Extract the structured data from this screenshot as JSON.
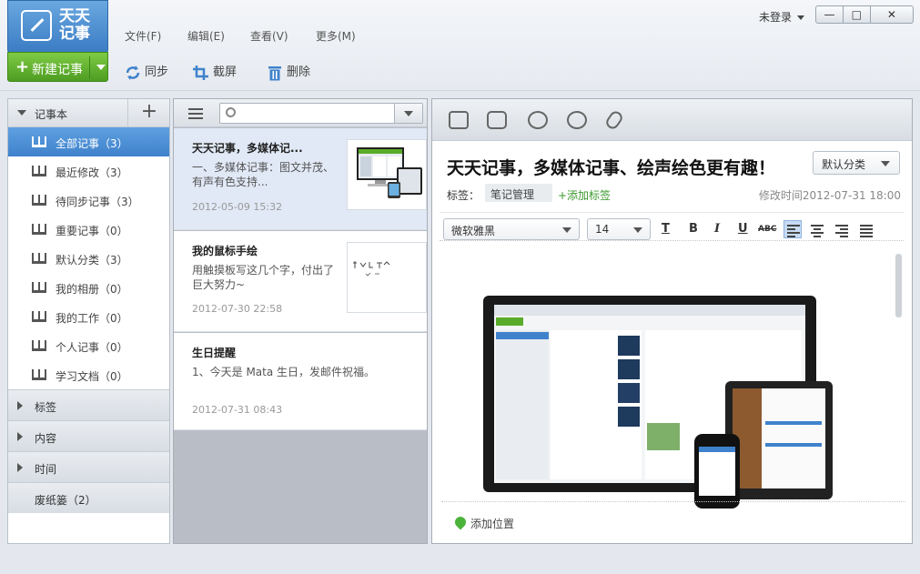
{
  "app": {
    "logo_text": "天天记事",
    "new_note_label": "新建记事"
  },
  "menu": [
    "文件(F)",
    "编辑(E)",
    "查看(V)",
    "更多(M)"
  ],
  "toolbar": {
    "sync": "同步",
    "screenshot": "截屏",
    "delete": "删除"
  },
  "user": {
    "status": "未登录"
  },
  "window": {
    "min": "—",
    "max": "□",
    "close": "✕"
  },
  "sidebar": {
    "header": "记事本",
    "add": "+",
    "notebooks": [
      {
        "label": "全部记事（3）",
        "selected": true
      },
      {
        "label": "最近修改（3）"
      },
      {
        "label": "待同步记事（3）"
      },
      {
        "label": "重要记事（0）"
      },
      {
        "label": "默认分类（3）"
      },
      {
        "label": "我的相册（0）"
      },
      {
        "label": "我的工作（0）"
      },
      {
        "label": "个人记事（0）"
      },
      {
        "label": "学习文档（0）"
      }
    ],
    "sections": [
      "标签",
      "内容",
      "时间"
    ],
    "trash": "废纸篓（2）"
  },
  "notes": [
    {
      "title": "天天记事，多媒体记...",
      "snippet": "一、多媒体记事：图文并茂、有声有色支持...",
      "date": "2012-05-09 15:32",
      "selected": true
    },
    {
      "title": "我的鼠标手绘",
      "snippet": "用触摸板写这几个字，付出了巨大努力~",
      "date": "2012-07-30 22:58"
    },
    {
      "title": "生日提醒",
      "snippet": "1、今天是 Mata 生日，发邮件祝福。",
      "date": "2012-07-31 08:43"
    }
  ],
  "editor": {
    "title": "天天记事，多媒体记事、绘声绘色更有趣！",
    "category": "默认分类",
    "tag_label": "标签：",
    "tag": "笔记管理",
    "add_tag": "+添加标签",
    "modified": "修改时间2012-07-31 18:00",
    "font": "微软雅黑",
    "size": "14",
    "format": {
      "color": "T",
      "bold": "B",
      "italic": "I",
      "underline": "U",
      "strike": "ABC"
    },
    "add_location": "添加位置"
  },
  "colors": {
    "accent": "#3f82cc",
    "new_button": "#5aab2a",
    "tag_green": "#3c9a2e"
  }
}
